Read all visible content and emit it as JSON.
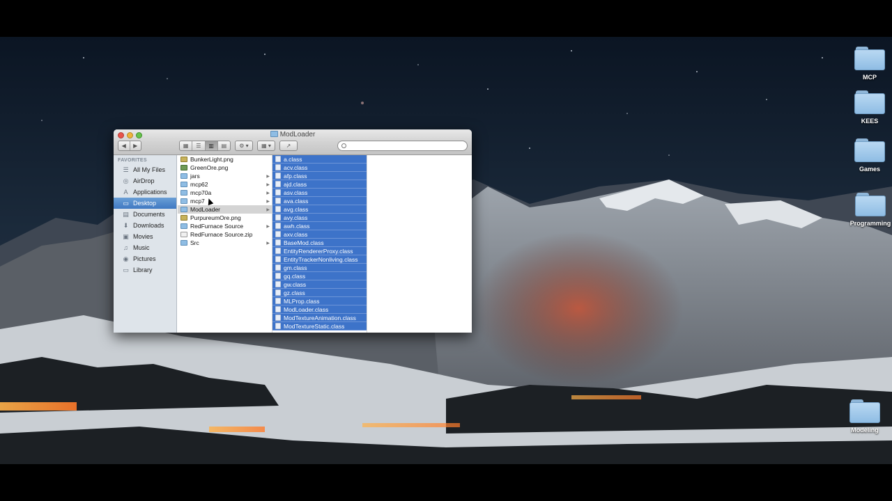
{
  "window": {
    "title": "ModLoader",
    "toolbar": {
      "back_label": "◀",
      "forward_label": "▶",
      "view_icons": "▦",
      "view_list": "☰",
      "view_columns": "▥",
      "view_coverflow": "▤",
      "action_label": "⚙ ▾",
      "arrange_label": "▦ ▾",
      "share_label": "↗"
    },
    "search": {
      "placeholder": ""
    }
  },
  "sidebar": {
    "heading": "FAVORITES",
    "items": [
      {
        "label": "All My Files",
        "icon": "☰"
      },
      {
        "label": "AirDrop",
        "icon": "◎"
      },
      {
        "label": "Applications",
        "icon": "A"
      },
      {
        "label": "Desktop",
        "icon": "▭"
      },
      {
        "label": "Documents",
        "icon": "▤"
      },
      {
        "label": "Downloads",
        "icon": "⬇"
      },
      {
        "label": "Movies",
        "icon": "▣"
      },
      {
        "label": "Music",
        "icon": "♫"
      },
      {
        "label": "Pictures",
        "icon": "◉"
      },
      {
        "label": "Library",
        "icon": "▭"
      }
    ]
  },
  "column1": [
    {
      "name": "BunkerLight.png",
      "kind": "img"
    },
    {
      "name": "GreenOre.png",
      "kind": "img2"
    },
    {
      "name": "jars",
      "kind": "folder"
    },
    {
      "name": "mcp62",
      "kind": "folder"
    },
    {
      "name": "mcp70a",
      "kind": "folder"
    },
    {
      "name": "mcp7",
      "kind": "folder"
    },
    {
      "name": "ModLoader",
      "kind": "folder"
    },
    {
      "name": "PurpureumOre.png",
      "kind": "img"
    },
    {
      "name": "RedFurnace Source",
      "kind": "folder"
    },
    {
      "name": "RedFurnace Source.zip",
      "kind": "doc"
    },
    {
      "name": "Src",
      "kind": "folder"
    }
  ],
  "column2": [
    "a.class",
    "acv.class",
    "afp.class",
    "ajd.class",
    "asv.class",
    "ava.class",
    "avg.class",
    "avy.class",
    "awh.class",
    "axv.class",
    "BaseMod.class",
    "EntityRendererProxy.class",
    "EntityTrackerNonliving.class",
    "gm.class",
    "gq.class",
    "gw.class",
    "gz.class",
    "MLProp.class",
    "ModLoader.class",
    "ModTextureAnimation.class",
    "ModTextureStatic.class"
  ],
  "desktop_icons": [
    {
      "label": "MCP"
    },
    {
      "label": "KEES"
    },
    {
      "label": "Games"
    },
    {
      "label": "Programming"
    },
    {
      "label": "Modeling"
    }
  ]
}
